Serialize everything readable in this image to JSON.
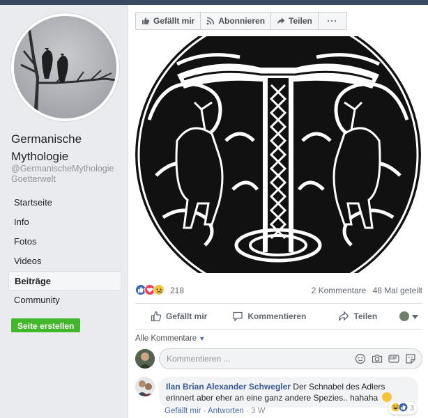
{
  "page": {
    "name_line1": "Germanische",
    "name_line2": "Mythologie",
    "handle_line1": "@GermanischeMythologie",
    "handle_line2": "Goetterwelt"
  },
  "nav": {
    "items": [
      {
        "label": "Startseite"
      },
      {
        "label": "Info"
      },
      {
        "label": "Fotos"
      },
      {
        "label": "Videos"
      },
      {
        "label": "Beiträge"
      },
      {
        "label": "Community"
      }
    ],
    "active_index": 4,
    "create_page": "Seite erstellen"
  },
  "action_bar": {
    "like": "Gefällt mir",
    "follow": "Abonnieren",
    "share": "Teilen",
    "more": "···"
  },
  "post": {
    "reactions_count": "218",
    "comments": "2 Kommentare",
    "shares": "48 Mal geteilt",
    "like": "Gefällt mir",
    "comment": "Kommentieren",
    "share": "Teilen"
  },
  "comments_section": {
    "filter": "Alle Kommentare",
    "placeholder": "Kommentieren ...",
    "gif": "GIF"
  },
  "comment": {
    "author": "Ilan Brian Alexander Schwegler",
    "text_line1": "Der Schnabel des Adlers",
    "text_line2": "erinnert aber eher an eine ganz andere Spezies.. hahaha",
    "like": "Gefällt mir",
    "reply": "Antworten",
    "sep": "·",
    "time": "3 W",
    "reaction_count": "3"
  },
  "colors": {
    "brand_blue": "#4267b2",
    "link_blue": "#385898",
    "create_green": "#42b72a",
    "love_red": "#f33e58",
    "haha_yellow": "#f5c33b"
  }
}
